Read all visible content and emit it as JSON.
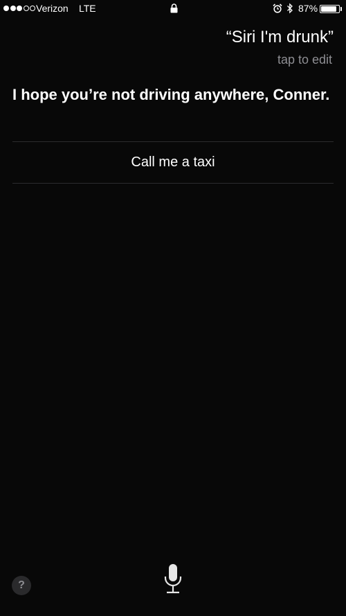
{
  "status_bar": {
    "signal_full": 3,
    "signal_total": 5,
    "carrier": "Verizon",
    "network": "LTE",
    "battery_text": "87%",
    "battery_level": 0.87,
    "icons": [
      "signal-dots",
      "lock-icon",
      "alarm-icon",
      "bluetooth-icon",
      "battery-icon"
    ]
  },
  "siri": {
    "query": "“Siri I'm drunk”",
    "tap_to_edit": "tap to edit",
    "response": "I hope you’re not driving anywhere, Conner.",
    "suggestion": "Call me a taxi"
  },
  "bottom": {
    "help_label": "?",
    "mic_icon": "microphone-icon"
  },
  "colors": {
    "background": "#080808",
    "text": "#ffffff",
    "secondary_text": "#8e8e93",
    "divider": "#2c2c2e"
  }
}
